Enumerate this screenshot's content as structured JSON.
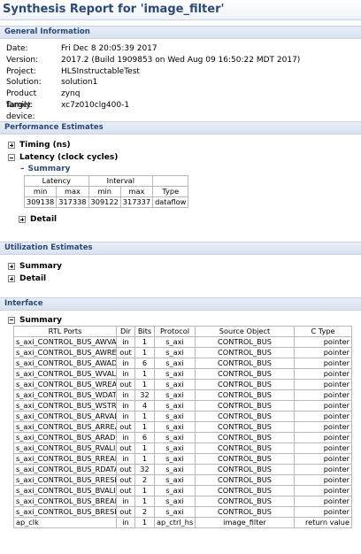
{
  "title": "Synthesis Report for 'image_filter'",
  "general": {
    "header": "General Information",
    "rows": [
      {
        "label": "Date:",
        "value": "Fri Dec 8 20:05:39 2017"
      },
      {
        "label": "Version:",
        "value": "2017.2 (Build 1909853 on Wed Aug 09 16:50:22 MDT 2017)"
      },
      {
        "label": "Project:",
        "value": "HLSInstructableTest"
      },
      {
        "label": "Solution:",
        "value": "solution1"
      },
      {
        "label": "Product family:",
        "value": "zynq"
      },
      {
        "label": "Target device:",
        "value": "xc7z010clg400-1"
      }
    ]
  },
  "performance": {
    "header": "Performance Estimates",
    "timing": "Timing (ns)",
    "latency": "Latency (clock cycles)",
    "summary": "Summary",
    "detail": "Detail",
    "table": {
      "group_latency": "Latency",
      "group_interval": "Interval",
      "cols": [
        "min",
        "max",
        "min",
        "max",
        "Type"
      ],
      "row": [
        "309138",
        "317338",
        "309122",
        "317337",
        "dataflow"
      ]
    }
  },
  "utilization": {
    "header": "Utilization Estimates",
    "summary": "Summary",
    "detail": "Detail"
  },
  "interface": {
    "header": "Interface",
    "summary": "Summary",
    "columns": [
      "RTL Ports",
      "Dir",
      "Bits",
      "Protocol",
      "Source Object",
      "C Type"
    ],
    "rows": [
      [
        "s_axi_CONTROL_BUS_AWVALID",
        "in",
        "1",
        "s_axi",
        "CONTROL_BUS",
        "pointer"
      ],
      [
        "s_axi_CONTROL_BUS_AWREADY",
        "out",
        "1",
        "s_axi",
        "CONTROL_BUS",
        "pointer"
      ],
      [
        "s_axi_CONTROL_BUS_AWADDR",
        "in",
        "6",
        "s_axi",
        "CONTROL_BUS",
        "pointer"
      ],
      [
        "s_axi_CONTROL_BUS_WVALID",
        "in",
        "1",
        "s_axi",
        "CONTROL_BUS",
        "pointer"
      ],
      [
        "s_axi_CONTROL_BUS_WREADY",
        "out",
        "1",
        "s_axi",
        "CONTROL_BUS",
        "pointer"
      ],
      [
        "s_axi_CONTROL_BUS_WDATA",
        "in",
        "32",
        "s_axi",
        "CONTROL_BUS",
        "pointer"
      ],
      [
        "s_axi_CONTROL_BUS_WSTRB",
        "in",
        "4",
        "s_axi",
        "CONTROL_BUS",
        "pointer"
      ],
      [
        "s_axi_CONTROL_BUS_ARVALID",
        "in",
        "1",
        "s_axi",
        "CONTROL_BUS",
        "pointer"
      ],
      [
        "s_axi_CONTROL_BUS_ARREADY",
        "out",
        "1",
        "s_axi",
        "CONTROL_BUS",
        "pointer"
      ],
      [
        "s_axi_CONTROL_BUS_ARADDR",
        "in",
        "6",
        "s_axi",
        "CONTROL_BUS",
        "pointer"
      ],
      [
        "s_axi_CONTROL_BUS_RVALID",
        "out",
        "1",
        "s_axi",
        "CONTROL_BUS",
        "pointer"
      ],
      [
        "s_axi_CONTROL_BUS_RREADY",
        "in",
        "1",
        "s_axi",
        "CONTROL_BUS",
        "pointer"
      ],
      [
        "s_axi_CONTROL_BUS_RDATA",
        "out",
        "32",
        "s_axi",
        "CONTROL_BUS",
        "pointer"
      ],
      [
        "s_axi_CONTROL_BUS_RRESP",
        "out",
        "2",
        "s_axi",
        "CONTROL_BUS",
        "pointer"
      ],
      [
        "s_axi_CONTROL_BUS_BVALID",
        "out",
        "1",
        "s_axi",
        "CONTROL_BUS",
        "pointer"
      ],
      [
        "s_axi_CONTROL_BUS_BREADY",
        "in",
        "1",
        "s_axi",
        "CONTROL_BUS",
        "pointer"
      ],
      [
        "s_axi_CONTROL_BUS_BRESP",
        "out",
        "2",
        "s_axi",
        "CONTROL_BUS",
        "pointer"
      ],
      [
        "ap_clk",
        "in",
        "1",
        "ap_ctrl_hs",
        "image_filter",
        "return value"
      ]
    ]
  }
}
